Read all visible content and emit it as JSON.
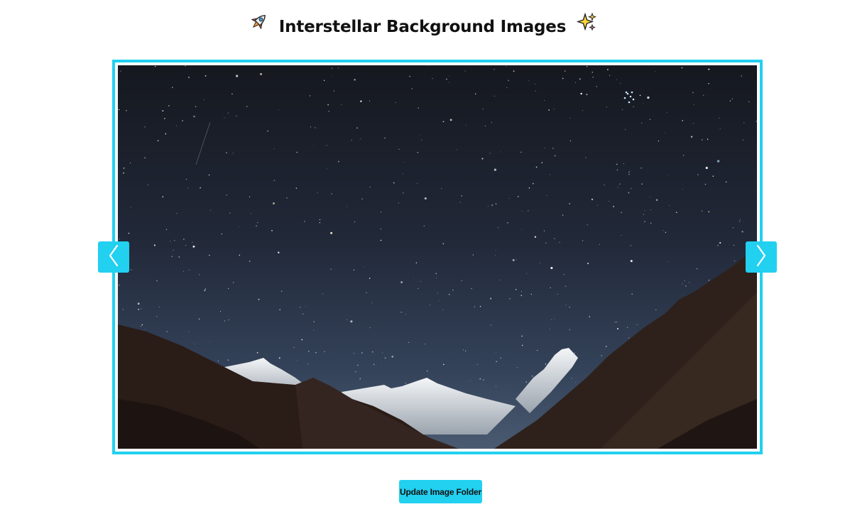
{
  "header": {
    "title": "Interstellar Background Images"
  },
  "slider": {
    "prev_icon": "chevron-left-icon",
    "next_icon": "chevron-right-icon",
    "accent_color": "#22d0f0"
  },
  "actions": {
    "update_label": "Update Image Folder"
  }
}
